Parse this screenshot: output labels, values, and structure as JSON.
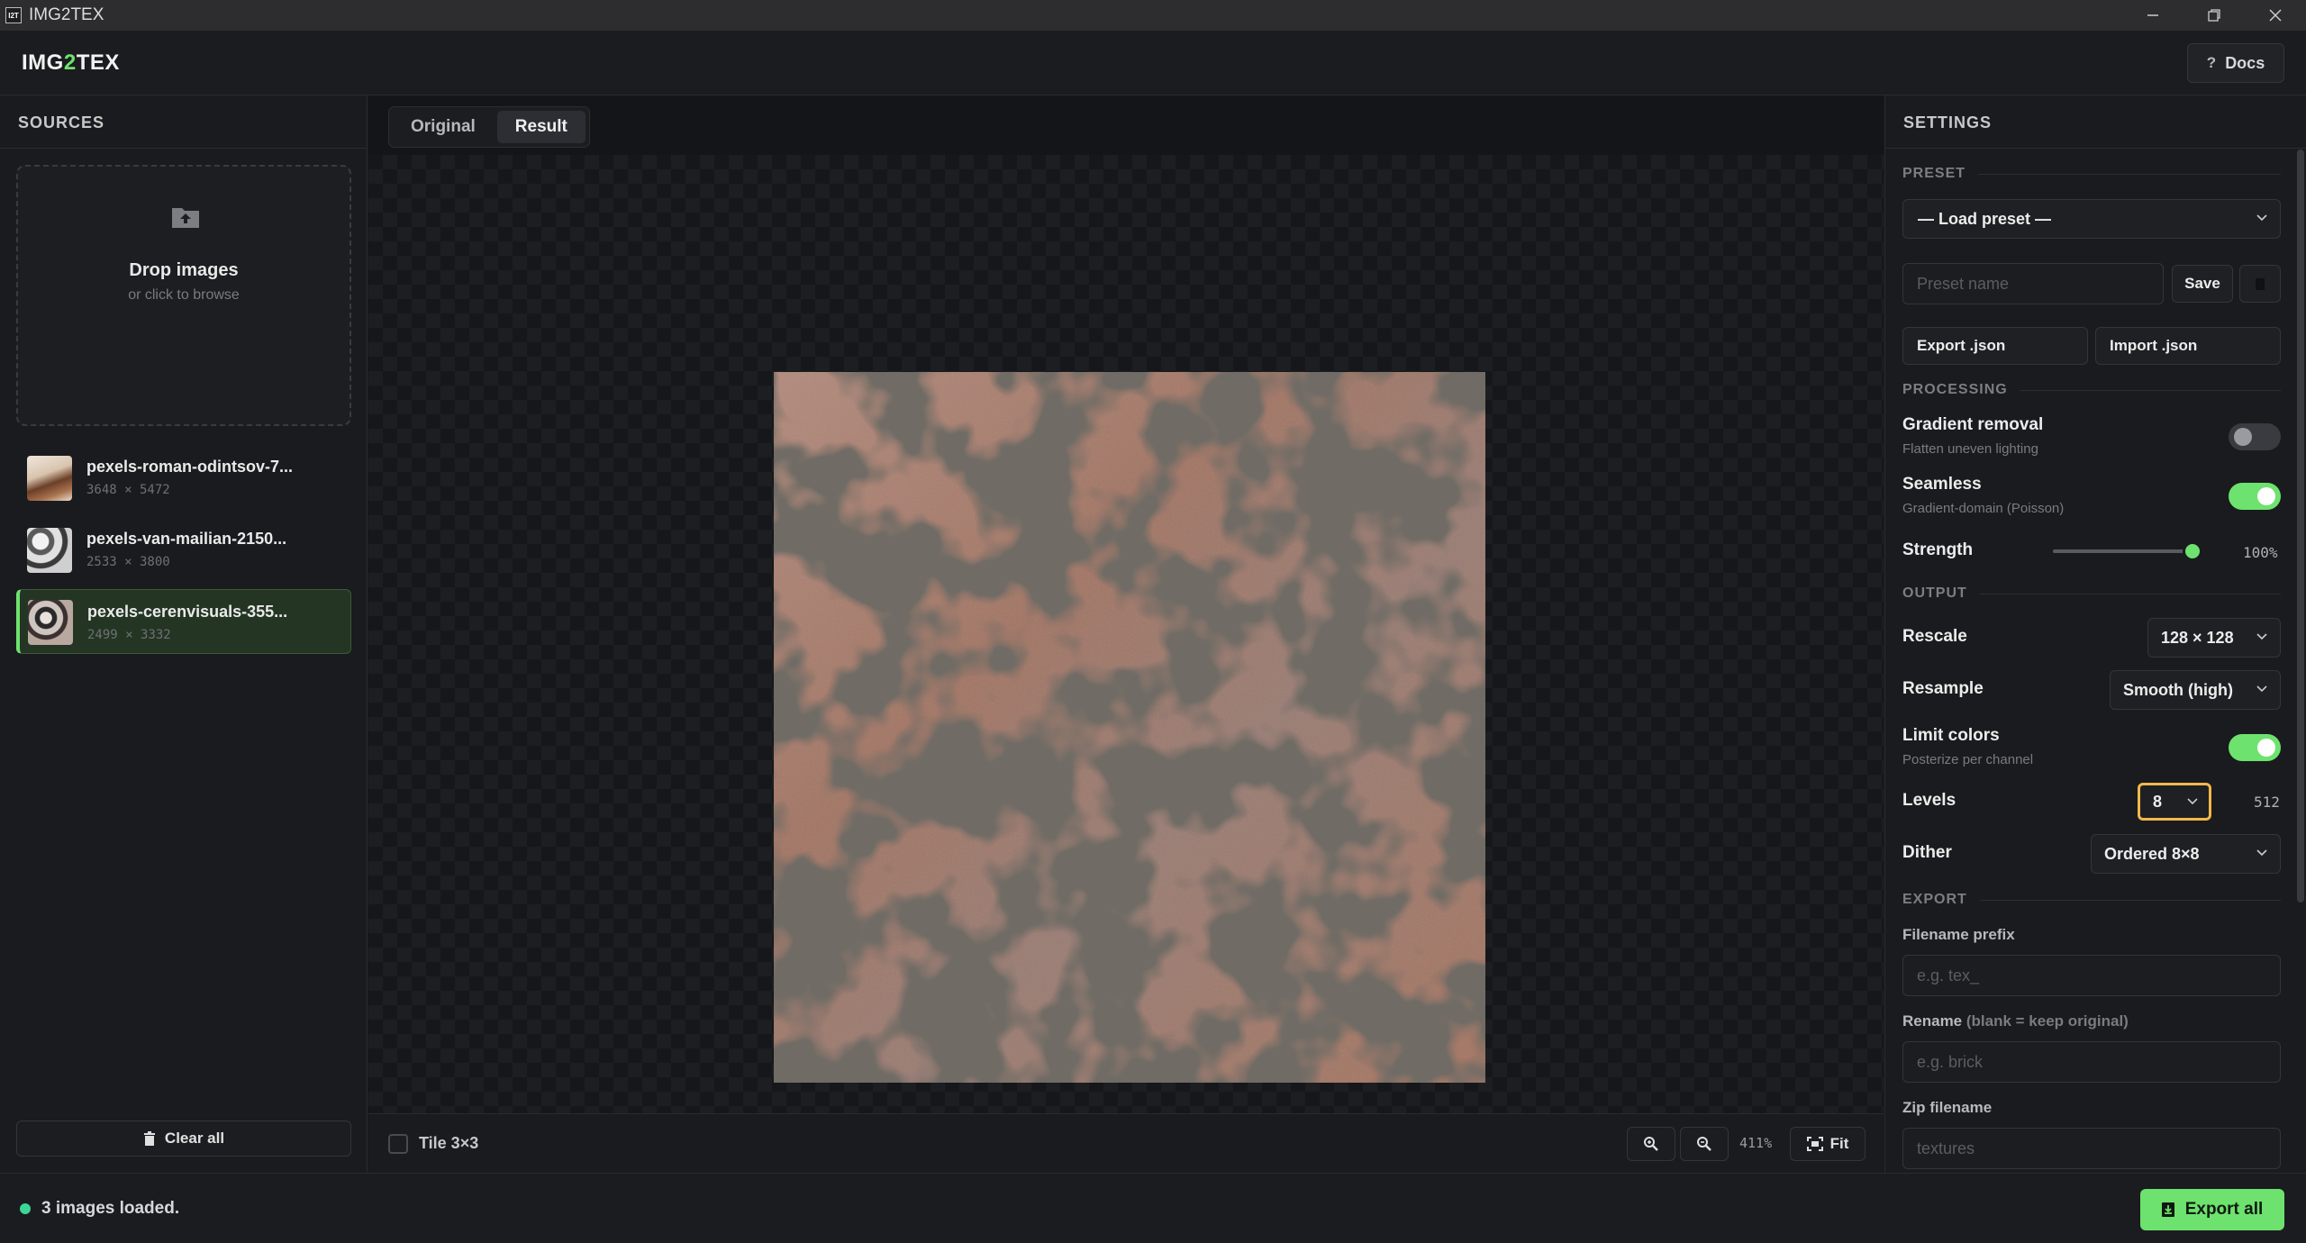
{
  "window": {
    "title": "IMG2TEX",
    "icon_text": "I2T"
  },
  "header": {
    "logo_prefix": "IMG",
    "logo_accent": "2",
    "logo_suffix": "TEX",
    "docs_label": "Docs",
    "accent_color": "#6ee26e"
  },
  "sources": {
    "title": "SOURCES",
    "drop_title": "Drop images",
    "drop_subtitle": "or click to browse",
    "files": [
      {
        "name": "pexels-roman-odintsov-7...",
        "dims": "3648 × 5472",
        "active": false
      },
      {
        "name": "pexels-van-mailian-2150...",
        "dims": "2533 × 3800",
        "active": false
      },
      {
        "name": "pexels-cerenvisuals-355...",
        "dims": "2499 × 3332",
        "active": true
      }
    ],
    "clear_label": "Clear all"
  },
  "viewer": {
    "tabs": [
      {
        "label": "Original",
        "active": false
      },
      {
        "label": "Result",
        "active": true
      }
    ],
    "tile_label": "Tile 3×3",
    "tile_checked": false,
    "zoom_level": "411%",
    "fit_label": "Fit"
  },
  "settings": {
    "title": "SETTINGS",
    "preset": {
      "group": "PRESET",
      "load_value": "— Load preset —",
      "name_placeholder": "Preset name",
      "save_label": "Save",
      "export_label": "Export .json",
      "import_label": "Import .json"
    },
    "processing": {
      "group": "PROCESSING",
      "gradient_label": "Gradient removal",
      "gradient_sub": "Flatten uneven lighting",
      "gradient_on": false,
      "seamless_label": "Seamless",
      "seamless_sub": "Gradient-domain (Poisson)",
      "seamless_on": true,
      "strength_label": "Strength",
      "strength_value": "100%",
      "strength_fraction": 1.0
    },
    "output": {
      "group": "OUTPUT",
      "rescale_label": "Rescale",
      "rescale_value": "128 × 128",
      "resample_label": "Resample",
      "resample_value": "Smooth (high)",
      "limit_label": "Limit colors",
      "limit_sub": "Posterize per channel",
      "limit_on": true,
      "levels_label": "Levels",
      "levels_value": "8",
      "levels_count": "512",
      "dither_label": "Dither",
      "dither_value": "Ordered 8×8"
    },
    "export": {
      "group": "EXPORT",
      "prefix_label": "Filename prefix",
      "prefix_placeholder": "e.g. tex_",
      "rename_label": "Rename",
      "rename_hint": "(blank = keep original)",
      "rename_placeholder": "e.g. brick",
      "zip_label": "Zip filename",
      "zip_placeholder": "textures"
    }
  },
  "status": {
    "text": "3 images loaded.",
    "export_label": "Export all",
    "dot_color": "#3ed598"
  }
}
